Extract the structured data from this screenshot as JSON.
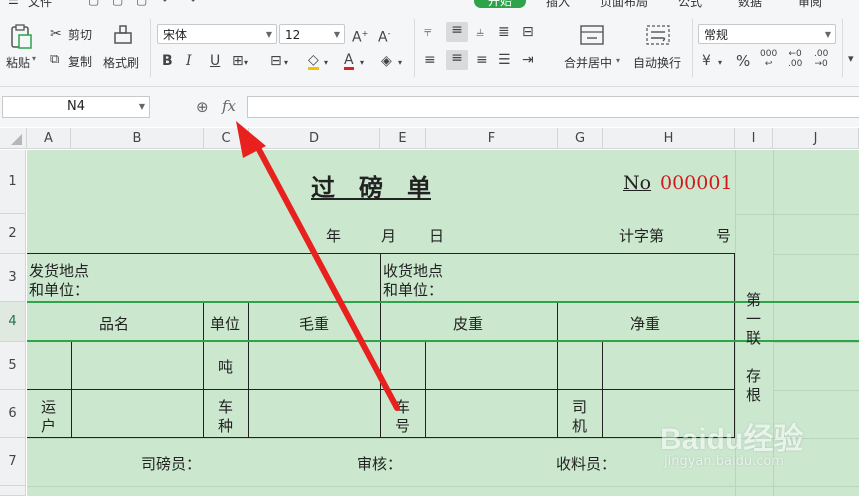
{
  "ribbon": {
    "tabs": [
      {
        "label": "文件",
        "active": false
      },
      {
        "label": "开始",
        "active": true
      },
      {
        "label": "插入",
        "active": false
      },
      {
        "label": "页面布局",
        "active": false
      },
      {
        "label": "公式",
        "active": false
      },
      {
        "label": "数据",
        "active": false
      },
      {
        "label": "审阅",
        "active": false
      }
    ],
    "paste_label": "粘贴",
    "cut_label": "剪切",
    "copy_label": "复制",
    "format_painter_label": "格式刷",
    "font_name": "宋体",
    "font_size": "12",
    "merge_center_label": "合并居中",
    "wrap_text_label": "自动换行",
    "number_format": "常规",
    "percent_symbol": "%",
    "increase_decimal": ".000 → .0",
    "decrease_decimal": ".00 → .0"
  },
  "formula_bar": {
    "cell_ref": "N4",
    "fx_label": "fx",
    "content": ""
  },
  "grid": {
    "columns": [
      "A",
      "B",
      "C",
      "D",
      "E",
      "F",
      "G",
      "H",
      "I",
      "J"
    ],
    "rows": [
      "1",
      "2",
      "3",
      "4",
      "5",
      "6",
      "7"
    ],
    "selected_row": "4"
  },
  "form": {
    "title": "过　磅　单",
    "no_label": "No",
    "no_value": "000001",
    "date_year": "年",
    "date_month": "月",
    "date_day": "日",
    "counter_prefix": "计字第",
    "counter_suffix": "号",
    "ship_from_1": "发货地点",
    "ship_from_2": "和单位：",
    "ship_to_1": "收货地点",
    "ship_to_2": "和单位：",
    "col_name": "品名",
    "col_unit": "单位",
    "col_gross": "毛重",
    "col_tare": "皮重",
    "col_net": "净重",
    "unit_ton": "吨",
    "carrier_1": "运",
    "carrier_2": "户",
    "vehicle_type_1": "车",
    "vehicle_type_2": "种",
    "plate_1": "车",
    "plate_2": "号",
    "driver_1": "司",
    "driver_2": "机",
    "copy_note": [
      "第",
      "一",
      "联",
      "",
      "存",
      "根"
    ],
    "weigher_label": "司磅员：",
    "auditor_label": "审核：",
    "receiver_label": "收料员："
  },
  "watermark": {
    "brand": "Baidu经验",
    "url": "jingyan.baidu.com"
  },
  "colors": {
    "accent": "#2fa34a",
    "sheet_fill": "#cbe8cf",
    "arrow": "#e8211f",
    "number_red": "#d0191b"
  }
}
